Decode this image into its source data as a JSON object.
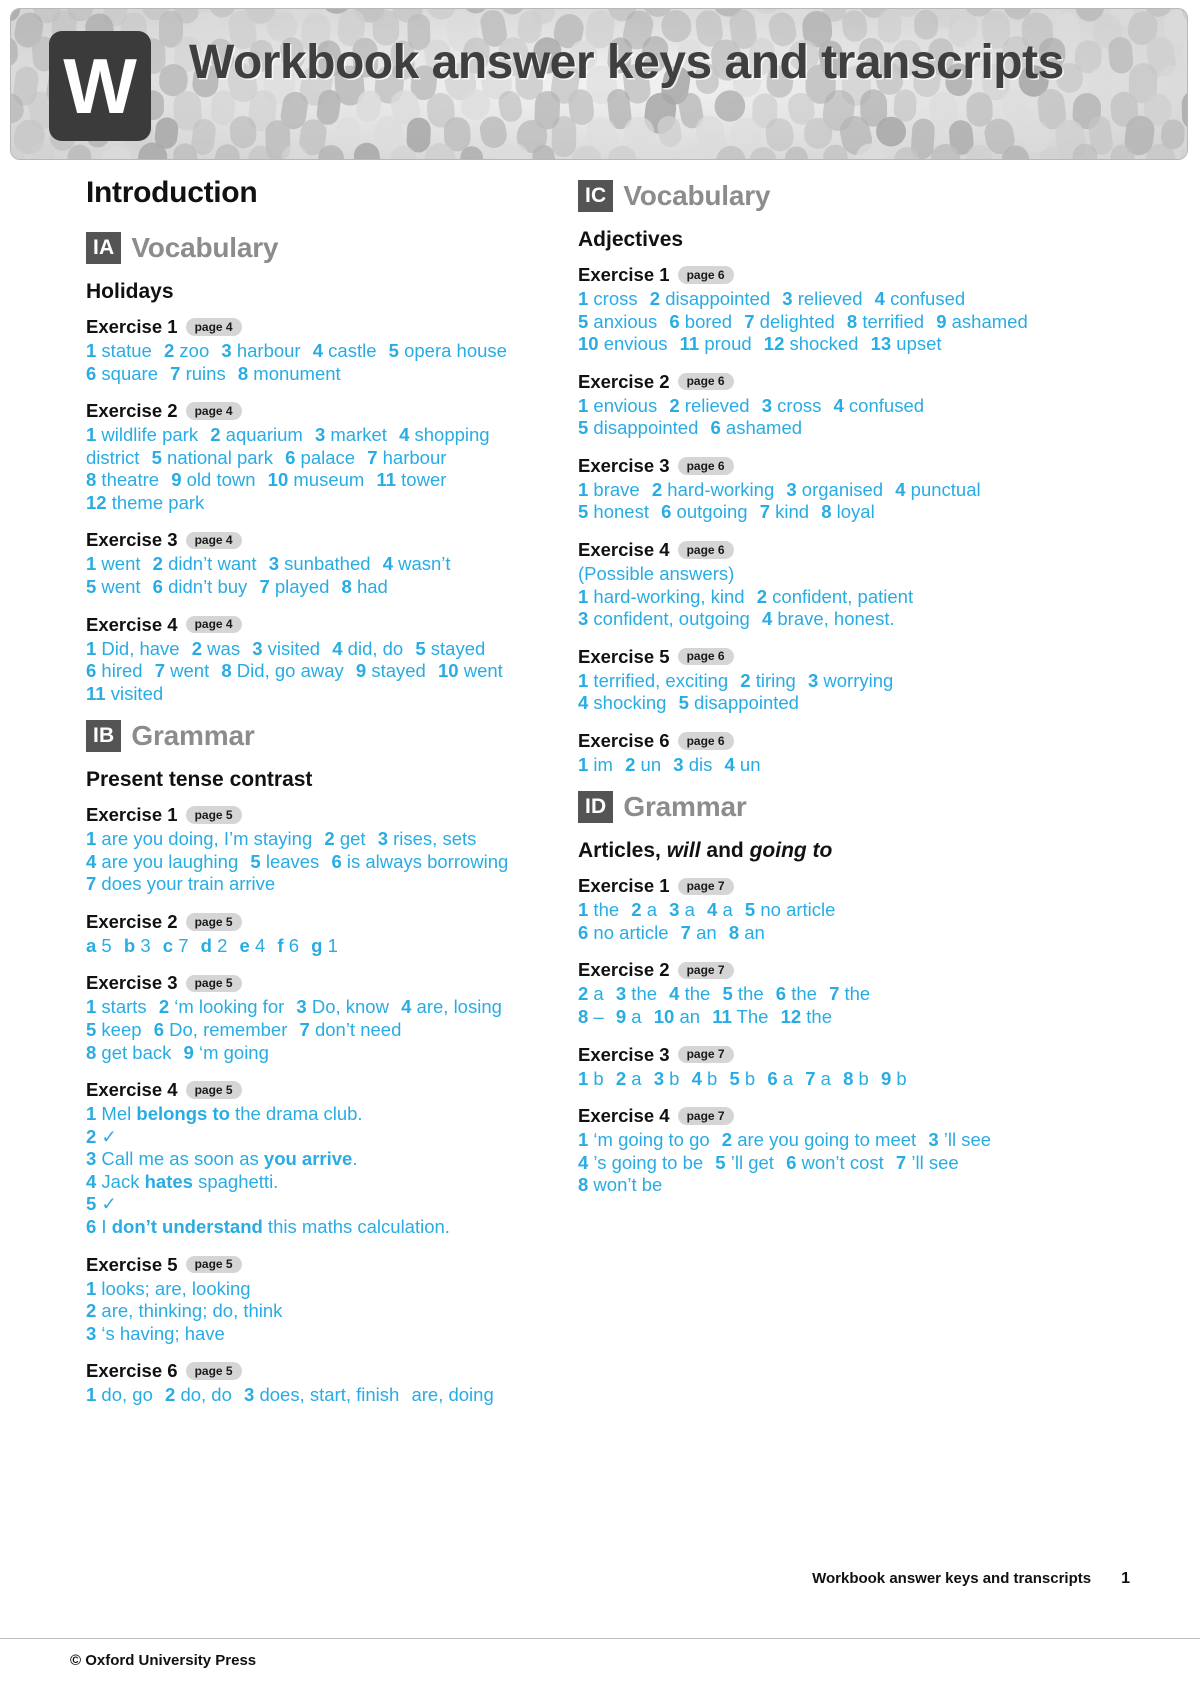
{
  "banner": {
    "badge_letter": "W",
    "title": "Workbook answer keys and transcripts"
  },
  "footer": {
    "copyright": "© Oxford University Press",
    "doc_title": "Workbook answer keys and transcripts",
    "page_number": "1"
  },
  "left_column": {
    "unit_title": "Introduction",
    "sections": [
      {
        "badge": "IA",
        "label": "Vocabulary",
        "topic": "Holidays",
        "exercises": [
          {
            "title": "Exercise 1",
            "page": "page 4",
            "lines": [
              "<span class=\"n\">1</span> statue<span class=\"sp\"></span> <span class=\"n\">2</span> zoo<span class=\"sp\"></span> <span class=\"n\">3</span> harbour<span class=\"sp\"></span> <span class=\"n\">4</span> castle<span class=\"sp\"></span> <span class=\"n\">5</span> opera house",
              "<span class=\"n\">6</span> square<span class=\"sp\"></span> <span class=\"n\">7</span> ruins<span class=\"sp\"></span> <span class=\"n\">8</span> monument"
            ]
          },
          {
            "title": "Exercise 2",
            "page": "page 4",
            "lines": [
              "<span class=\"n\">1</span> wildlife park<span class=\"sp\"></span> <span class=\"n\">2</span> aquarium<span class=\"sp\"></span> <span class=\"n\">3</span> market<span class=\"sp\"></span> <span class=\"n\">4</span> shopping",
              "district<span class=\"sp\"></span> <span class=\"n\">5</span> national park<span class=\"sp\"></span> <span class=\"n\">6</span> palace<span class=\"sp\"></span> <span class=\"n\">7</span> harbour",
              "<span class=\"n\">8</span> theatre<span class=\"sp\"></span> <span class=\"n\">9</span> old town<span class=\"sp\"></span> <span class=\"n\">10</span> museum<span class=\"sp\"></span> <span class=\"n\">11</span> tower",
              "<span class=\"n\">12</span> theme park"
            ]
          },
          {
            "title": "Exercise 3",
            "page": "page 4",
            "lines": [
              "<span class=\"n\">1</span> went<span class=\"sp\"></span> <span class=\"n\">2</span> didn’t want<span class=\"sp\"></span> <span class=\"n\">3</span> sunbathed<span class=\"sp\"></span> <span class=\"n\">4</span> wasn’t",
              "<span class=\"n\">5</span> went<span class=\"sp\"></span> <span class=\"n\">6</span> didn’t buy<span class=\"sp\"></span> <span class=\"n\">7</span> played<span class=\"sp\"></span> <span class=\"n\">8</span> had"
            ]
          },
          {
            "title": "Exercise 4",
            "page": "page 4",
            "lines": [
              "<span class=\"n\">1</span> Did, have<span class=\"sp\"></span> <span class=\"n\">2</span> was<span class=\"sp\"></span> <span class=\"n\">3</span> visited<span class=\"sp\"></span> <span class=\"n\">4</span> did, do<span class=\"sp\"></span> <span class=\"n\">5</span> stayed",
              "<span class=\"n\">6</span> hired<span class=\"sp\"></span> <span class=\"n\">7</span> went<span class=\"sp\"></span> <span class=\"n\">8</span> Did, go away<span class=\"sp\"></span> <span class=\"n\">9</span> stayed<span class=\"sp\"></span> <span class=\"n\">10</span> went",
              "<span class=\"n\">11</span> visited"
            ]
          }
        ]
      },
      {
        "badge": "IB",
        "label": "Grammar",
        "topic": "Present tense contrast",
        "exercises": [
          {
            "title": "Exercise 1",
            "page": "page 5",
            "lines": [
              "<span class=\"n\">1</span> are you doing, I’m staying<span class=\"sp\"></span> <span class=\"n\">2</span> get<span class=\"sp\"></span> <span class=\"n\">3</span> rises, sets",
              "<span class=\"n\">4</span> are you laughing<span class=\"sp\"></span> <span class=\"n\">5</span> leaves<span class=\"sp\"></span> <span class=\"n\">6</span> is always borrowing",
              "<span class=\"n\">7</span> does your train arrive"
            ]
          },
          {
            "title": "Exercise 2",
            "page": "page 5",
            "lines": [
              "<span class=\"n\">a</span> 5<span class=\"sp\"></span> <span class=\"n\">b</span> 3<span class=\"sp\"></span> <span class=\"n\">c</span> 7<span class=\"sp\"></span> <span class=\"n\">d</span> 2<span class=\"sp\"></span> <span class=\"n\">e</span> 4<span class=\"sp\"></span> <span class=\"n\">f</span> 6<span class=\"sp\"></span> <span class=\"n\">g</span> 1"
            ]
          },
          {
            "title": "Exercise 3",
            "page": "page 5",
            "lines": [
              "<span class=\"n\">1</span> starts<span class=\"sp\"></span> <span class=\"n\">2</span> ‘m looking for<span class=\"sp\"></span> <span class=\"n\">3</span> Do, know<span class=\"sp\"></span> <span class=\"n\">4</span> are, losing",
              "<span class=\"n\">5</span> keep<span class=\"sp\"></span> <span class=\"n\">6</span> Do, remember<span class=\"sp\"></span> <span class=\"n\">7</span> don’t need",
              "<span class=\"n\">8</span> get back<span class=\"sp\"></span> <span class=\"n\">9</span> ‘m going"
            ]
          },
          {
            "title": "Exercise 4",
            "page": "page 5",
            "lines": [
              "<span class=\"n\">1</span> Mel <b>belongs to</b> the drama club.",
              "<span class=\"n\">2</span> ✓",
              "<span class=\"n\">3</span> Call me as soon as <b>you arrive</b>.",
              "<span class=\"n\">4</span> Jack <b>hates</b> spaghetti.",
              "<span class=\"n\">5</span> ✓",
              "<span class=\"n\">6</span> I <b>don’t understand</b> this maths calculation."
            ]
          },
          {
            "title": "Exercise 5",
            "page": "page 5",
            "lines": [
              "<span class=\"n\">1</span> looks; are, looking",
              "<span class=\"n\">2</span> are, thinking; do, think",
              "<span class=\"n\">3</span> ‘s having; have"
            ]
          },
          {
            "title": "Exercise 6",
            "page": "page 5",
            "lines": [
              "<span class=\"n\">1</span> do, go<span class=\"sp\"></span> <span class=\"n\">2</span> do, do<span class=\"sp\"></span> <span class=\"n\">3</span> does, start, finish<span class=\"sp\"></span> are, doing"
            ]
          }
        ]
      }
    ]
  },
  "right_column": {
    "sections": [
      {
        "badge": "IC",
        "label": "Vocabulary",
        "topic": "Adjectives",
        "exercises": [
          {
            "title": "Exercise 1",
            "page": "page 6",
            "lines": [
              "<span class=\"n\">1</span> cross<span class=\"sp\"></span> <span class=\"n\">2</span> disappointed<span class=\"sp\"></span> <span class=\"n\">3</span> relieved<span class=\"sp\"></span> <span class=\"n\">4</span> confused",
              "<span class=\"n\">5</span> anxious<span class=\"sp\"></span> <span class=\"n\">6</span> bored<span class=\"sp\"></span> <span class=\"n\">7</span> delighted<span class=\"sp\"></span> <span class=\"n\">8</span> terrified<span class=\"sp\"></span> <span class=\"n\">9</span> ashamed",
              "<span class=\"n\">10</span> envious<span class=\"sp\"></span> <span class=\"n\">11</span> proud<span class=\"sp\"></span> <span class=\"n\">12</span> shocked<span class=\"sp\"></span> <span class=\"n\">13</span> upset"
            ]
          },
          {
            "title": "Exercise 2",
            "page": "page 6",
            "lines": [
              "<span class=\"n\">1</span> envious<span class=\"sp\"></span> <span class=\"n\">2</span> relieved<span class=\"sp\"></span> <span class=\"n\">3</span> cross<span class=\"sp\"></span> <span class=\"n\">4</span> confused",
              "<span class=\"n\">5</span> disappointed<span class=\"sp\"></span> <span class=\"n\">6</span> ashamed"
            ]
          },
          {
            "title": "Exercise 3",
            "page": "page 6",
            "lines": [
              "<span class=\"n\">1</span> brave<span class=\"sp\"></span> <span class=\"n\">2</span> hard-working<span class=\"sp\"></span> <span class=\"n\">3</span> organised<span class=\"sp\"></span> <span class=\"n\">4</span> punctual",
              "<span class=\"n\">5</span> honest<span class=\"sp\"></span> <span class=\"n\">6</span> outgoing<span class=\"sp\"></span> <span class=\"n\">7</span> kind<span class=\"sp\"></span> <span class=\"n\">8</span> loyal"
            ]
          },
          {
            "title": "Exercise 4",
            "page": "page 6",
            "lines": [
              "(Possible answers)",
              "<span class=\"n\">1</span> hard-working, kind<span class=\"sp\"></span> <span class=\"n\">2</span> confident, patient",
              "<span class=\"n\">3</span> confident, outgoing<span class=\"sp\"></span> <span class=\"n\">4</span> brave, honest."
            ]
          },
          {
            "title": "Exercise 5",
            "page": "page 6",
            "lines": [
              "<span class=\"n\">1</span> terrified, exciting<span class=\"sp\"></span> <span class=\"n\">2</span> tiring<span class=\"sp\"></span> <span class=\"n\">3</span> worrying",
              "<span class=\"n\">4</span> shocking<span class=\"sp\"></span> <span class=\"n\">5</span> disappointed"
            ]
          },
          {
            "title": "Exercise 6",
            "page": "page 6",
            "lines": [
              "<span class=\"n\">1</span> im<span class=\"sp\"></span> <span class=\"n\">2</span> un<span class=\"sp\"></span> <span class=\"n\">3</span> dis<span class=\"sp\"></span> <span class=\"n\">4</span> un"
            ]
          }
        ]
      },
      {
        "badge": "ID",
        "label": "Grammar",
        "topic": "Articles, <em>will</em> and <em>going to</em>",
        "exercises": [
          {
            "title": "Exercise 1",
            "page": "page 7",
            "lines": [
              "<span class=\"n\">1</span> the<span class=\"sp\"></span> <span class=\"n\">2</span> a<span class=\"sp\"></span> <span class=\"n\">3</span> a<span class=\"sp\"></span> <span class=\"n\">4</span> a<span class=\"sp\"></span> <span class=\"n\">5</span> no article",
              "<span class=\"n\">6</span> no article<span class=\"sp\"></span> <span class=\"n\">7</span> an<span class=\"sp\"></span> <span class=\"n\">8</span> an"
            ]
          },
          {
            "title": "Exercise 2",
            "page": "page 7",
            "lines": [
              "<span class=\"n\">2</span> a<span class=\"sp\"></span> <span class=\"n\">3</span> the<span class=\"sp\"></span> <span class=\"n\">4</span> the<span class=\"sp\"></span> <span class=\"n\">5</span> the<span class=\"sp\"></span> <span class=\"n\">6</span> the<span class=\"sp\"></span> <span class=\"n\">7</span> the",
              "<span class=\"n\">8</span> –<span class=\"sp\"></span> <span class=\"n\">9</span> a<span class=\"sp\"></span> <span class=\"n\">10</span> an<span class=\"sp\"></span> <span class=\"n\">11</span> The<span class=\"sp\"></span> <span class=\"n\">12</span> the"
            ]
          },
          {
            "title": "Exercise 3",
            "page": "page 7",
            "lines": [
              "<span class=\"n\">1</span> b<span class=\"sp\"></span> <span class=\"n\">2</span> a<span class=\"sp\"></span> <span class=\"n\">3</span> b<span class=\"sp\"></span> <span class=\"n\">4</span> b<span class=\"sp\"></span> <span class=\"n\">5</span> b<span class=\"sp\"></span> <span class=\"n\">6</span> a<span class=\"sp\"></span> <span class=\"n\">7</span> a<span class=\"sp\"></span> <span class=\"n\">8</span> b<span class=\"sp\"></span> <span class=\"n\">9</span> b"
            ]
          },
          {
            "title": "Exercise 4",
            "page": "page 7",
            "lines": [
              "<span class=\"n\">1</span> ‘m going to go<span class=\"sp\"></span> <span class=\"n\">2</span> are you going to meet<span class=\"sp\"></span> <span class=\"n\">3</span> ’ll see",
              "<span class=\"n\">4</span> ’s going to be<span class=\"sp\"></span> <span class=\"n\">5</span> ’ll get<span class=\"sp\"></span> <span class=\"n\">6</span> won’t cost<span class=\"sp\"></span> <span class=\"n\">7</span> ’ll see",
              "<span class=\"n\">8</span> won’t be"
            ]
          }
        ]
      }
    ]
  },
  "colors": {
    "answer_blue": "#29ace3",
    "badge_gray": "#545454",
    "pill_gray": "#d5d5d5",
    "label_gray": "#8c8c8c"
  }
}
